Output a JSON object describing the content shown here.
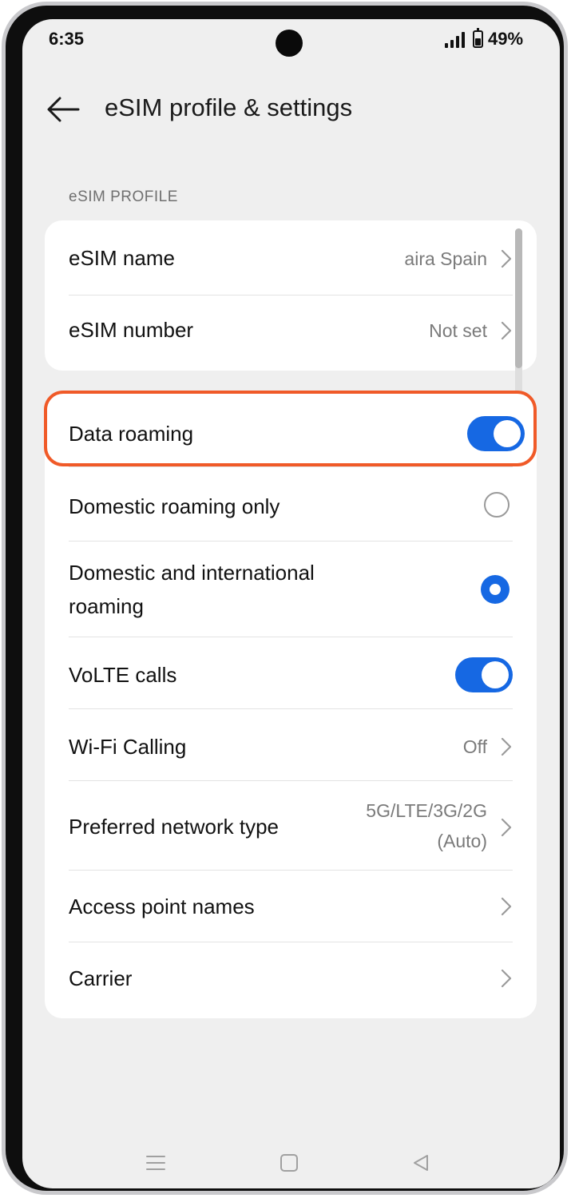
{
  "status_bar": {
    "time": "6:35",
    "battery_percent": "49%",
    "battery_level": 0.49
  },
  "header": {
    "title": "eSIM profile & settings",
    "back_icon": "arrow-left-icon"
  },
  "section_profile": {
    "heading": "eSIM PROFILE"
  },
  "profile_items": [
    {
      "label": "eSIM name",
      "value": "aira Spain"
    },
    {
      "label": "eSIM number",
      "value": "Not set"
    }
  ],
  "roaming": {
    "data_roaming": {
      "label": "Data roaming",
      "enabled": true
    },
    "domestic_only": {
      "label": "Domestic roaming only",
      "selected": false
    },
    "domestic_international": {
      "label_line1": "Domestic and international",
      "label_line2": "roaming",
      "selected": true
    }
  },
  "settings": {
    "volte": {
      "label": "VoLTE calls",
      "enabled": true
    },
    "wifi_calling": {
      "label": "Wi-Fi Calling",
      "value": "Off"
    },
    "network_type": {
      "label": "Preferred network type",
      "value_line1": "5G/LTE/3G/2G",
      "value_line2": "(Auto)"
    },
    "apn": {
      "label": "Access point names"
    },
    "carrier": {
      "label": "Carrier"
    }
  },
  "colors": {
    "accent": "#1668e3",
    "highlight": "#f05a28",
    "background": "#efefef",
    "card": "#ffffff"
  },
  "icons": {
    "chevron": "chevron-right-icon",
    "nav_menu": "menu-icon",
    "nav_home": "home-square-icon",
    "nav_back": "triangle-back-icon"
  }
}
